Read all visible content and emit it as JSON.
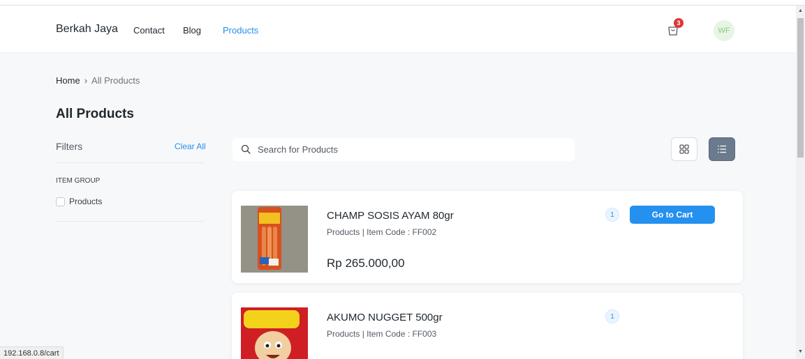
{
  "nav": {
    "brand": "Berkah Jaya",
    "links": [
      "Contact",
      "Blog",
      "Products"
    ],
    "cart_count": "3",
    "avatar_initials": "WF",
    "accent": "#2490ef"
  },
  "breadcrumb": {
    "home": "Home",
    "separator": "›",
    "current": "All Products"
  },
  "page": {
    "title": "All Products"
  },
  "filters": {
    "title": "Filters",
    "clear_all": "Clear All",
    "group_label": "ITEM GROUP",
    "options": [
      {
        "label": "Products",
        "checked": false
      }
    ]
  },
  "search": {
    "placeholder": "Search for Products",
    "value": ""
  },
  "view_toggle": {
    "active": "list",
    "options": [
      "grid",
      "list"
    ]
  },
  "products": [
    {
      "name": "CHAMP SOSIS AYAM 80gr",
      "meta": "Products | Item Code : FF002",
      "price": "Rp 265.000,00",
      "qty": "1",
      "button_label": "Go to Cart"
    },
    {
      "name": "AKUMO NUGGET 500gr",
      "meta": "Products | Item Code : FF003",
      "qty": "1"
    }
  ],
  "status_bar": {
    "url": "192.168.0.8/cart"
  }
}
